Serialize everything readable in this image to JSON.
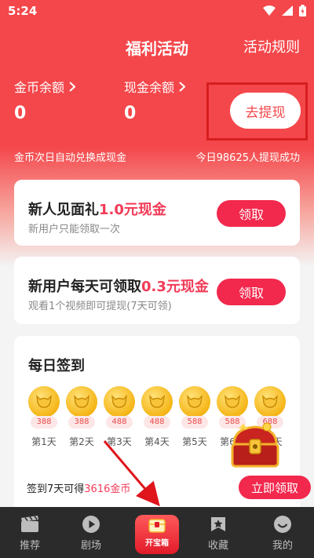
{
  "status": {
    "time": "5:24"
  },
  "header": {
    "title": "福利活动",
    "rules": "活动规则"
  },
  "balances": {
    "coin_label": "金币余额",
    "coin_value": "0",
    "cash_label": "现金余额",
    "cash_value": "0",
    "withdraw": "去提现"
  },
  "notes": {
    "auto_exchange": "金币次日自动兑换成现金",
    "today": "今日98625人提现成功"
  },
  "cards": [
    {
      "title": "新人见面礼",
      "amount": "1.0元现金",
      "subtitle": "新用户只能领取一次",
      "button": "领取"
    },
    {
      "title": "新用户每天可领取",
      "amount": "0.3元现金",
      "subtitle": "观看1个视频即可提现(7天可领)",
      "button": "领取"
    }
  ],
  "checkin": {
    "title": "每日签到",
    "days": [
      {
        "amount": "388",
        "label": "第1天"
      },
      {
        "amount": "388",
        "label": "第2天"
      },
      {
        "amount": "488",
        "label": "第3天"
      },
      {
        "amount": "488",
        "label": "第4天"
      },
      {
        "amount": "588",
        "label": "第5天"
      },
      {
        "amount": "588",
        "label": "第6天"
      },
      {
        "amount": "688",
        "label": "第7天"
      }
    ],
    "note_prefix": "签到7天可得",
    "note_amount": "3616金币",
    "claim_now": "立即领取"
  },
  "tabs": [
    {
      "label": "推荐",
      "icon": "clapperboard-icon"
    },
    {
      "label": "剧场",
      "icon": "play-icon"
    },
    {
      "label": "开宝箱",
      "icon": "treasure-box-icon"
    },
    {
      "label": "收藏",
      "icon": "star-box-icon"
    },
    {
      "label": "我的",
      "icon": "smile-icon"
    }
  ],
  "colors": {
    "primary_red": "#f4474b",
    "button_red": "#f2284d",
    "amount_red": "#f23a57",
    "tabbar": "#2b2b2b"
  }
}
